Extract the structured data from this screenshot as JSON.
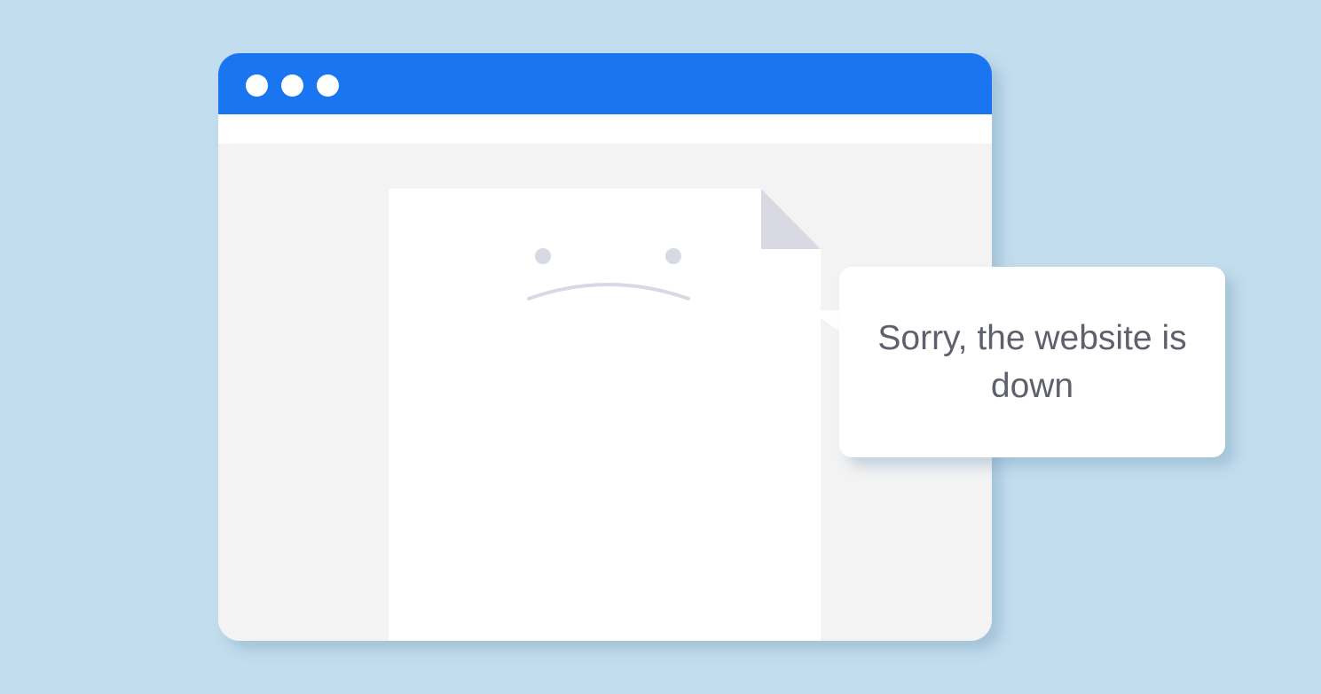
{
  "colors": {
    "background": "#c2dded",
    "title_bar": "#1a76f0",
    "window_body": "#f3f3f3",
    "page": "#ffffff",
    "page_fold": "#d8d9e3",
    "face_features": "#d7d9e4",
    "message_text": "#5e606b"
  },
  "browser": {
    "window_controls": [
      "window-dot-1",
      "window-dot-2",
      "window-dot-3"
    ]
  },
  "document": {
    "icon": "sad-face-icon"
  },
  "speech_bubble": {
    "message": "Sorry, the website is down"
  }
}
